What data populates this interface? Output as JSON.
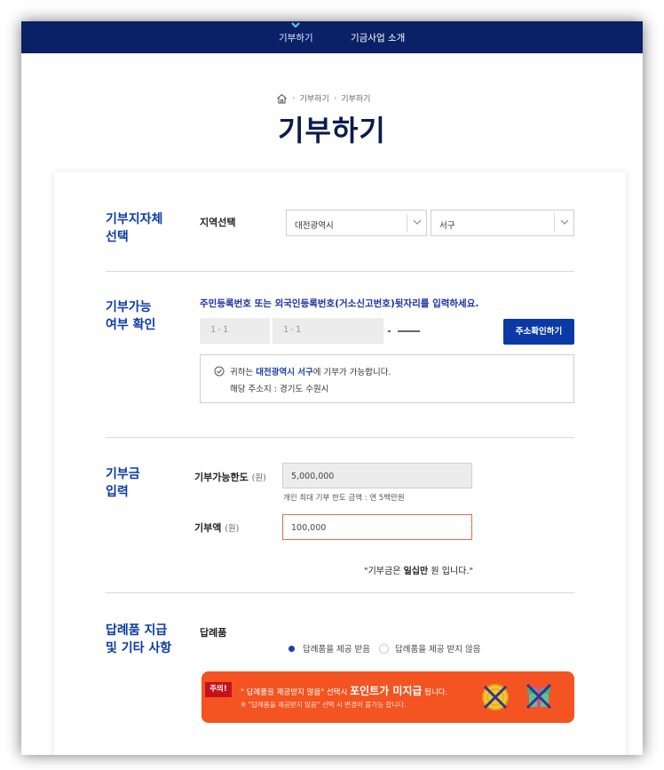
{
  "nav": {
    "donate": "기부하기",
    "intro": "기금사업 소개"
  },
  "breadcrumb": {
    "level1": "기부하기",
    "level2": "기부하기"
  },
  "page_title": "기부하기",
  "region": {
    "section_title_1": "기부지자체",
    "section_title_2": "선택",
    "label": "지역선택",
    "city": "대전광역시",
    "district": "서구"
  },
  "eligibility": {
    "section_title_1": "기부가능",
    "section_title_2": "여부 확인",
    "instruction": "주민등록번호 또는 외국인등록번호(거소신고번호)뒷자리를 입력하세요.",
    "masked_1": "1-1",
    "masked_2": "1-1",
    "button": "주소확인하기",
    "result_prefix": "귀하는",
    "result_region": "대전광역시 서구",
    "result_suffix": "에 기부가 가능합니다.",
    "address_line": "해당 주소지 : 경기도 수원시"
  },
  "amount": {
    "section_title_1": "기부금",
    "section_title_2": "입력",
    "limit_label": "기부가능한도",
    "unit": "(원)",
    "limit_value": "5,000,000",
    "limit_hint": "개인 최대 기부 한도 금액 : 연 5백만원",
    "donation_label": "기부액",
    "donation_value": "100,000",
    "note_prefix": "\"기부금은",
    "note_bold": "일십만",
    "note_suffix": "원 입니다.\""
  },
  "gift": {
    "section_title_1": "답례품 지급",
    "section_title_2": "및 기타 사항",
    "label": "답례품",
    "option_receive": "답례품을 제공 받음",
    "option_decline": "답례품을 제공 받지 않음",
    "alert_badge": "주의!",
    "alert_text": "\" 답례품을 제공받지 않음\" 선택시",
    "alert_big": "포인트가 미지급",
    "alert_end": "됩니다.",
    "alert_sub": "※ \"답례품을 제공받지 않음\" 선택 시 변경이 불가능 합니다."
  },
  "colors": {
    "nav_bg": "#0a2167",
    "accent_blue": "#0a3aa6",
    "alert_orange": "#f35421",
    "alert_badge": "#c5121a"
  }
}
